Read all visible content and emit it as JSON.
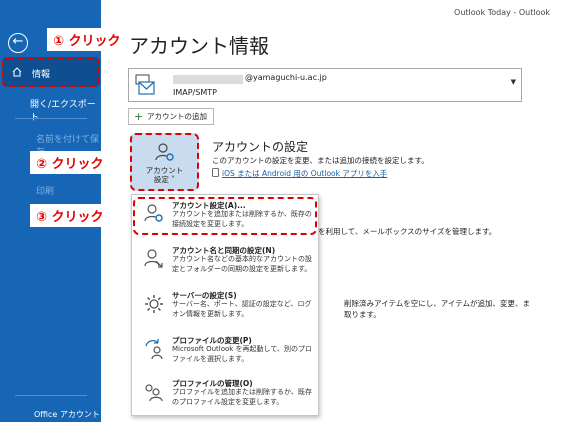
{
  "window": {
    "title": "Outlook Today  -  Outlook"
  },
  "sidebar": {
    "back_icon": "back-arrow-icon",
    "items": [
      {
        "label": "情報",
        "icon": "home-icon",
        "selected": true
      },
      {
        "label": "開く/エクスポート"
      },
      {
        "label": "名前を付けて保存"
      },
      {
        "label": "印刷"
      }
    ],
    "footer_label": "Office アカウント"
  },
  "callouts": {
    "step1": "① クリック",
    "step2": "② クリック",
    "step3": "③ クリック"
  },
  "page": {
    "title": "アカウント情報"
  },
  "account": {
    "email": "@yamaguchi-u.ac.jp",
    "type": "IMAP/SMTP"
  },
  "add_account": {
    "label": "アカウントの追加"
  },
  "account_settings": {
    "button_line1": "アカウント",
    "button_line2": "設定 ˅",
    "title": "アカウントの設定",
    "description": "このアカウントの設定を変更、または追加の接続を設定します。",
    "link": "iOS または Android 用の Outlook アプリを入手"
  },
  "background": {
    "text1": "を利用して、メールボックスのサイズを管理します。",
    "text2_line1": "削除済みアイテムを空にし、アイテムが追加、変更、ま",
    "text2_line2": "取ります。"
  },
  "menu": {
    "items": [
      {
        "title": "アカウント設定(A)...",
        "desc": "アカウントを追加または削除するか、既存の接続設定を変更します。"
      },
      {
        "title": "アカウント名と同期の設定(N)",
        "desc": "アカウント名などの基本的なアカウントの設定とフォルダーの同期の設定を更新します。"
      },
      {
        "title": "サーバーの設定(S)",
        "desc": "サーバー名、ポート、認証の設定など、ログオン情報を更新します。"
      },
      {
        "title": "プロファイルの変更(P)",
        "desc": "Microsoft Outlook を再起動して、別のプロファイルを選択します。"
      },
      {
        "title": "プロファイルの管理(O)",
        "desc": "プロファイルを追加または削除するか、既存のプロファイル設定を変更します。"
      }
    ]
  },
  "colors": {
    "sidebar": "#1766b5",
    "sidebar_selected": "#0f4f91",
    "callout_red": "#e00000",
    "link_blue": "#1a5fa8",
    "tile_blue": "#c9dcef"
  }
}
